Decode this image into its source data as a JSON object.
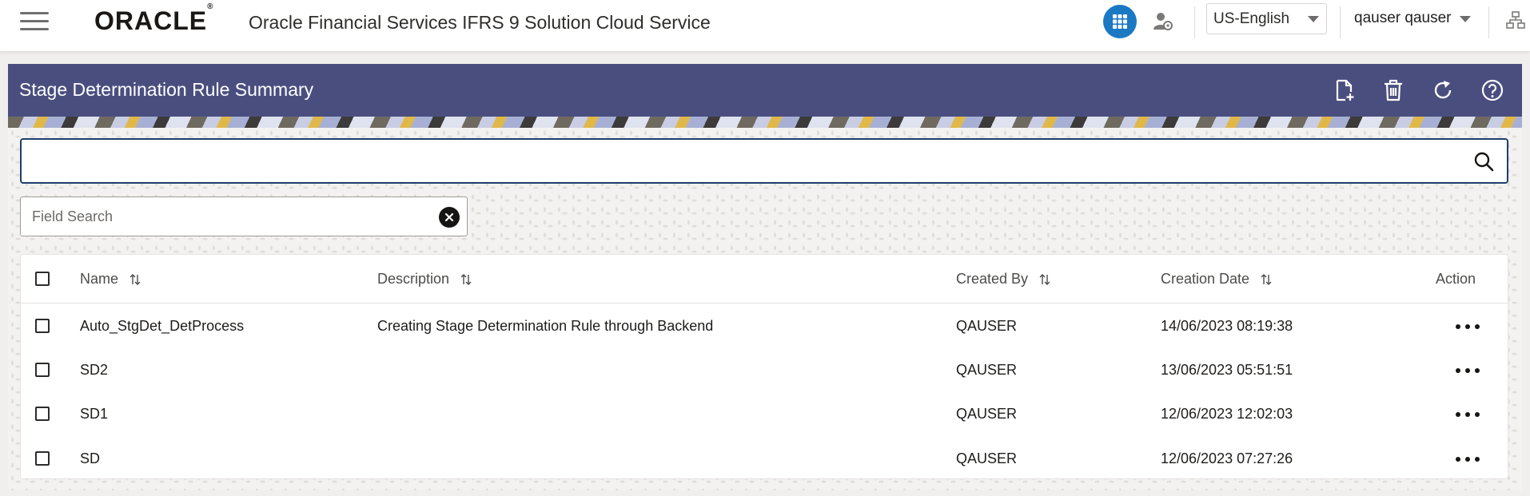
{
  "header": {
    "brand": "ORACLE",
    "brand_mark": "®",
    "app_title": "Oracle Financial Services IFRS 9 Solution Cloud Service",
    "language": "US-English",
    "user": "qauser qauser",
    "apps_icon": "grid-apps-icon",
    "admin_icon": "user-settings-icon",
    "hierarchy_icon": "hierarchy-icon",
    "accent_color": "#1b79c4"
  },
  "panel": {
    "title": "Stage Determination Rule Summary",
    "header_color": "#4a4e7f",
    "actions": [
      "add-document-icon",
      "delete-icon",
      "refresh-icon",
      "help-icon"
    ]
  },
  "search": {
    "value": "",
    "placeholder": ""
  },
  "field_search": {
    "placeholder": "Field Search"
  },
  "table": {
    "columns": [
      "Name",
      "Description",
      "Created By",
      "Creation Date",
      "Action"
    ],
    "rows": [
      {
        "name": "Auto_StgDet_DetProcess",
        "description": "Creating Stage Determination Rule through Backend",
        "created_by": "QAUSER",
        "creation_date": "14/06/2023 08:19:38"
      },
      {
        "name": "SD2",
        "description": "",
        "created_by": "QAUSER",
        "creation_date": "13/06/2023 05:51:51"
      },
      {
        "name": "SD1",
        "description": "",
        "created_by": "QAUSER",
        "creation_date": "12/06/2023 12:02:03"
      },
      {
        "name": "SD",
        "description": "",
        "created_by": "QAUSER",
        "creation_date": "12/06/2023 07:27:26"
      }
    ]
  }
}
